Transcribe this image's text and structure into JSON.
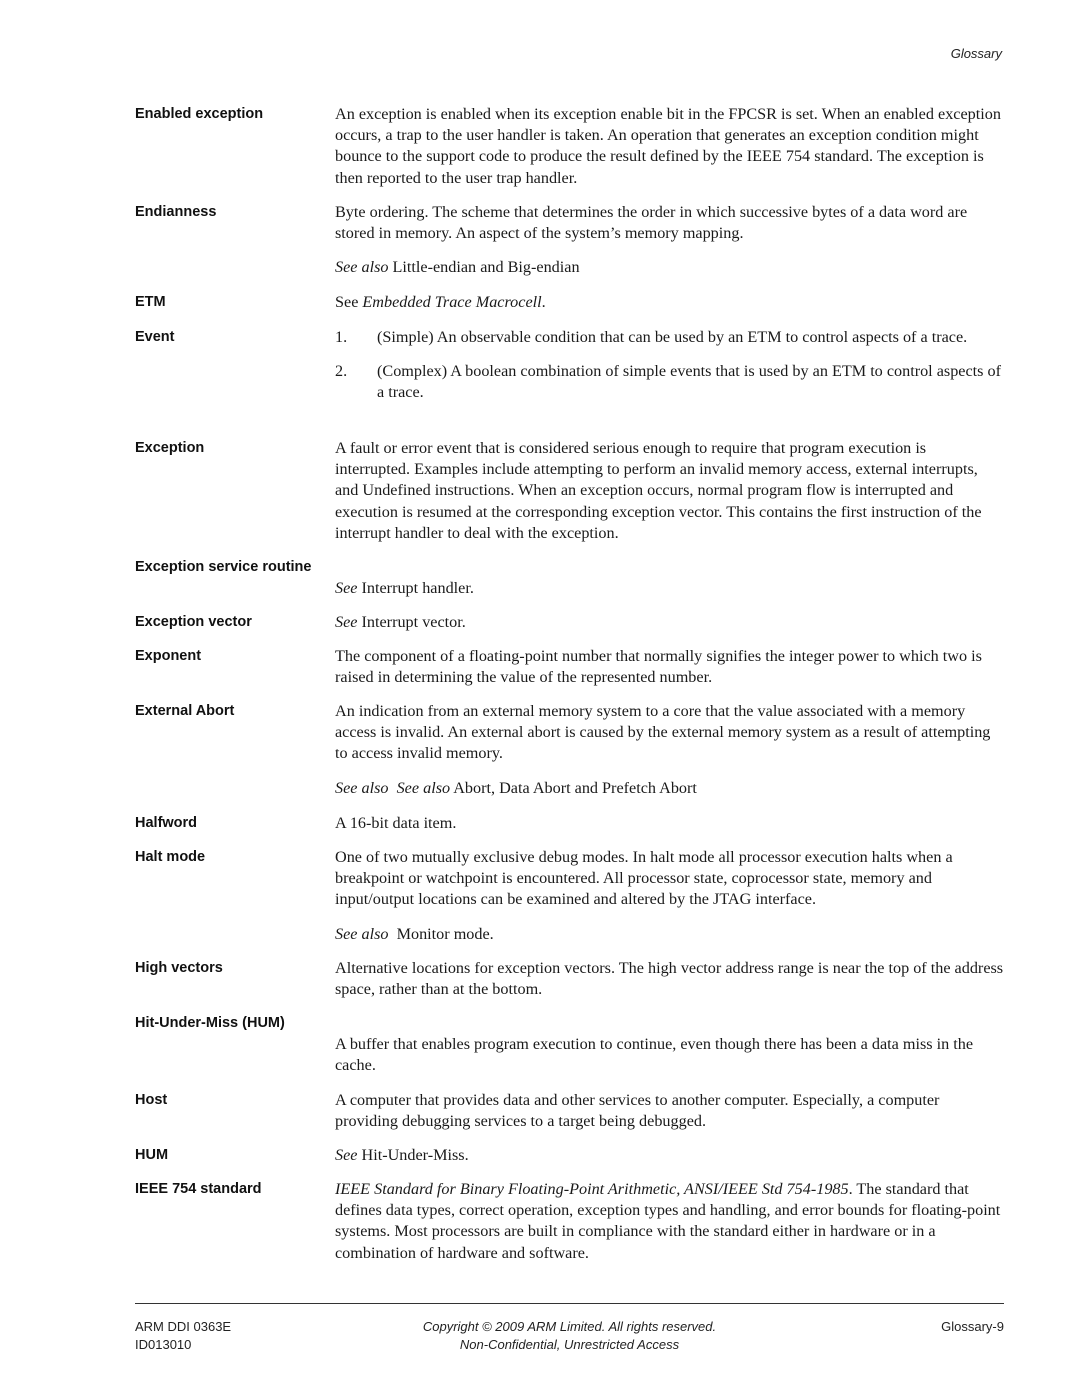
{
  "header": {
    "running_title": "Glossary"
  },
  "entries": [
    {
      "term": "Enabled exception",
      "definition": "An exception is enabled when its exception enable bit in the FPCSR is set. When an enabled exception occurs, a trap to the user handler is taken. An operation that generates an exception condition might bounce to the support code to produce the result defined by the IEEE 754 standard. The exception is then reported to the user trap handler."
    },
    {
      "term": "Endianness",
      "definition": "Byte ordering. The scheme that determines the order in which successive bytes of a data word are stored in memory. An aspect of the system’s memory mapping.",
      "see_also_label": "See also",
      "see_also_text": " Little-endian and Big-endian"
    },
    {
      "term": "ETM",
      "see_prefix": "See ",
      "see_italic": "Embedded Trace Macrocell",
      "see_suffix": "."
    },
    {
      "term": "Event",
      "items": [
        {
          "num": "1.",
          "text": "(Simple) An observable condition that can be used by an ETM to control aspects of a trace."
        },
        {
          "num": "2.",
          "text": "(Complex) A boolean combination of simple events that is used by an ETM to control aspects of a trace."
        }
      ]
    },
    {
      "term": "Exception",
      "definition": "A fault or error event that is considered serious enough to require that program execution is interrupted. Examples include attempting to perform an invalid memory access, external interrupts, and Undefined instructions. When an exception occurs, normal program flow is interrupted and execution is resumed at the corresponding exception vector. This contains the first instruction of the interrupt handler to deal with the exception."
    },
    {
      "term": "Exception service routine",
      "see_label": "See",
      "see_text": " Interrupt handler."
    },
    {
      "term": "Exception vector",
      "see_label": "See",
      "see_text": " Interrupt vector."
    },
    {
      "term": "Exponent",
      "definition": "The component of a floating-point number that normally signifies the integer power to which two is raised in determining the value of the represented number."
    },
    {
      "term": "External Abort",
      "definition": "An indication from an external memory system to a core that the value associated with a memory access is invalid. An external abort is caused by the external memory system as a result of attempting to access invalid memory.",
      "see_also_label": "See also  See also",
      "see_also_text": " Abort, Data Abort and Prefetch Abort"
    },
    {
      "term": "Halfword",
      "definition": "A 16-bit data item."
    },
    {
      "term": "Halt mode",
      "definition": "One of two mutually exclusive debug modes. In halt mode all processor execution halts when a breakpoint or watchpoint is encountered. All processor state, coprocessor state, memory and input/output locations can be examined and altered by the JTAG interface.",
      "see_also_label": "See also",
      "see_also_text": "  Monitor mode."
    },
    {
      "term": "High vectors",
      "definition": "Alternative locations for exception vectors. The high vector address range is near the top of the address space, rather than at the bottom."
    },
    {
      "term": "Hit-Under-Miss (HUM)",
      "definition": "A buffer that enables program execution to continue, even though there has been a data miss in the cache."
    },
    {
      "term": "Host",
      "definition": "A computer that provides data and other services to another computer. Especially, a computer providing debugging services to a target being debugged."
    },
    {
      "term": "HUM",
      "see_label": "See",
      "see_text": " Hit-Under-Miss."
    },
    {
      "term": "IEEE 754 standard",
      "italic_lead": "IEEE Standard for Binary Floating-Point Arithmetic, ANSI/IEEE Std 754-1985",
      "definition": ". The standard that defines data types, correct operation, exception types and handling, and error bounds for floating-point systems. Most processors are built in compliance with the standard either in hardware or in a combination of hardware and software."
    }
  ],
  "footer": {
    "doc_id": "ARM DDI 0363E",
    "doc_ref": "ID013010",
    "copyright": "Copyright © 2009 ARM Limited. All rights reserved.",
    "access": "Non-Confidential, Unrestricted Access",
    "page_number": "Glossary-9"
  }
}
